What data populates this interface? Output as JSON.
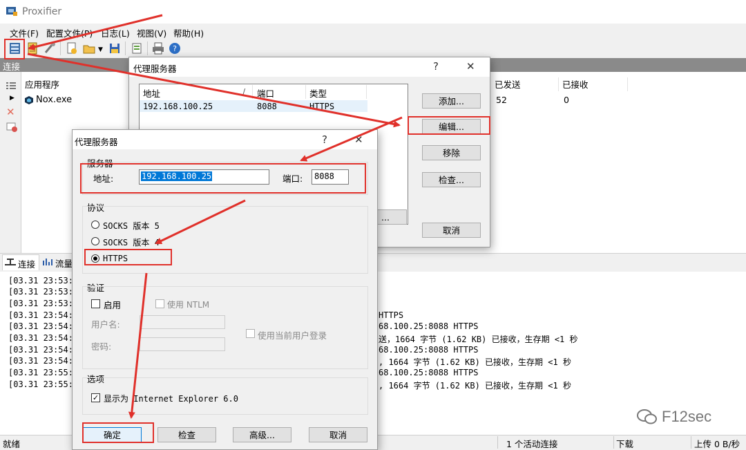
{
  "app": {
    "title": "Proxifier"
  },
  "menu": [
    "文件(F)",
    "配置文件(P)",
    "日志(L)",
    "视图(V)",
    "帮助(H)"
  ],
  "panel": {
    "header": "连接"
  },
  "columns": {
    "app": "应用程序",
    "sent": "已发送",
    "received": "已接收"
  },
  "connection_row": {
    "app": "Nox.exe",
    "sent": "52",
    "received": "0"
  },
  "tabs": [
    "连接",
    "流量"
  ],
  "log": {
    "left": [
      "[03.31 23:53:1",
      "[03.31 23:53:1",
      "[03.31 23:53:1",
      "[03.31 23:54:3",
      "[03.31 23:54:4",
      "[03.31 23:54:4",
      "[03.31 23:54:5",
      "[03.31 23:54:5",
      "[03.31 23:55:1",
      "[03.31 23:55:1"
    ],
    "right": [
      "",
      "",
      "",
      "HTTPS",
      "68.100.25:8088 HTTPS",
      "送，1664 字节 (1.62 KB) 已接收，生存期 <1 秒",
      "68.100.25:8088 HTTPS",
      ", 1664 字节 (1.62 KB) 已接收，生存期 <1 秒",
      "68.100.25:8088 HTTPS",
      ", 1664 字节 (1.62 KB) 已接收，生存期 <1 秒"
    ]
  },
  "status": {
    "ready": "就绪",
    "active": "1 个活动连接",
    "download": "下载",
    "upload": "上传 0 B/秒"
  },
  "proxy_list_dialog": {
    "title": "代理服务器",
    "help": "?",
    "close": "✕",
    "cols": {
      "address": "地址",
      "sort": "/",
      "port": "端口",
      "type": "类型"
    },
    "row": {
      "address": "192.168.100.25",
      "port": "8088",
      "type": "HTTPS"
    },
    "buttons": {
      "add": "添加...",
      "edit": "编辑...",
      "remove": "移除",
      "check": "检查...",
      "cancel": "取消",
      "partial": "..."
    }
  },
  "proxy_edit_dialog": {
    "title": "代理服务器",
    "help": "?",
    "close": "✕",
    "server_group": "服务器",
    "address_label": "地址:",
    "address_value": "192.168.100.25",
    "port_label": "端口:",
    "port_value": "8088",
    "protocol_group": "协议",
    "protocols": [
      "SOCKS 版本 5",
      "SOCKS 版本 4",
      "HTTPS"
    ],
    "auth_group": "验证",
    "enable_label": "启用",
    "ntlm_label": "使用 NTLM",
    "username_label": "用户名:",
    "password_label": "密码:",
    "current_user_label": "使用当前用户登录",
    "options_group": "选项",
    "show_ie_label": "显示为 Internet Explorer 6.0",
    "buttons": {
      "ok": "确定",
      "check": "检查",
      "advanced": "高级...",
      "cancel": "取消"
    }
  },
  "watermark": "F12sec",
  "colors": {
    "annotation": "#e0302a",
    "selection": "#0078d7"
  }
}
